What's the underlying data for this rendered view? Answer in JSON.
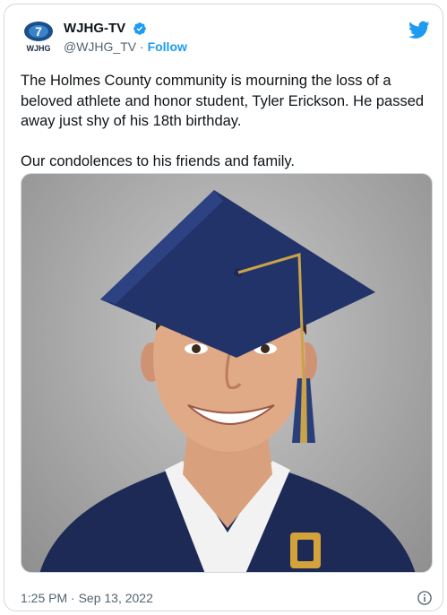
{
  "account": {
    "display_name": "WJHG-TV",
    "handle": "@WJHG_TV",
    "separator": "·",
    "follow_label": "Follow",
    "logo_text": "WJHG",
    "logo_number": "7",
    "brand_color": "#1d9bf0"
  },
  "tweet": {
    "text": "The Holmes County community is mourning the loss of a beloved athlete and honor student, Tyler Erickson. He passed away just shy of his 18th birthday.\n\nOur condolences to his friends and family.",
    "timestamp": "1:25 PM · Sep 13, 2022"
  },
  "icons": {
    "verified": "verified-badge-icon",
    "twitter": "twitter-bird-icon",
    "info": "info-icon"
  }
}
